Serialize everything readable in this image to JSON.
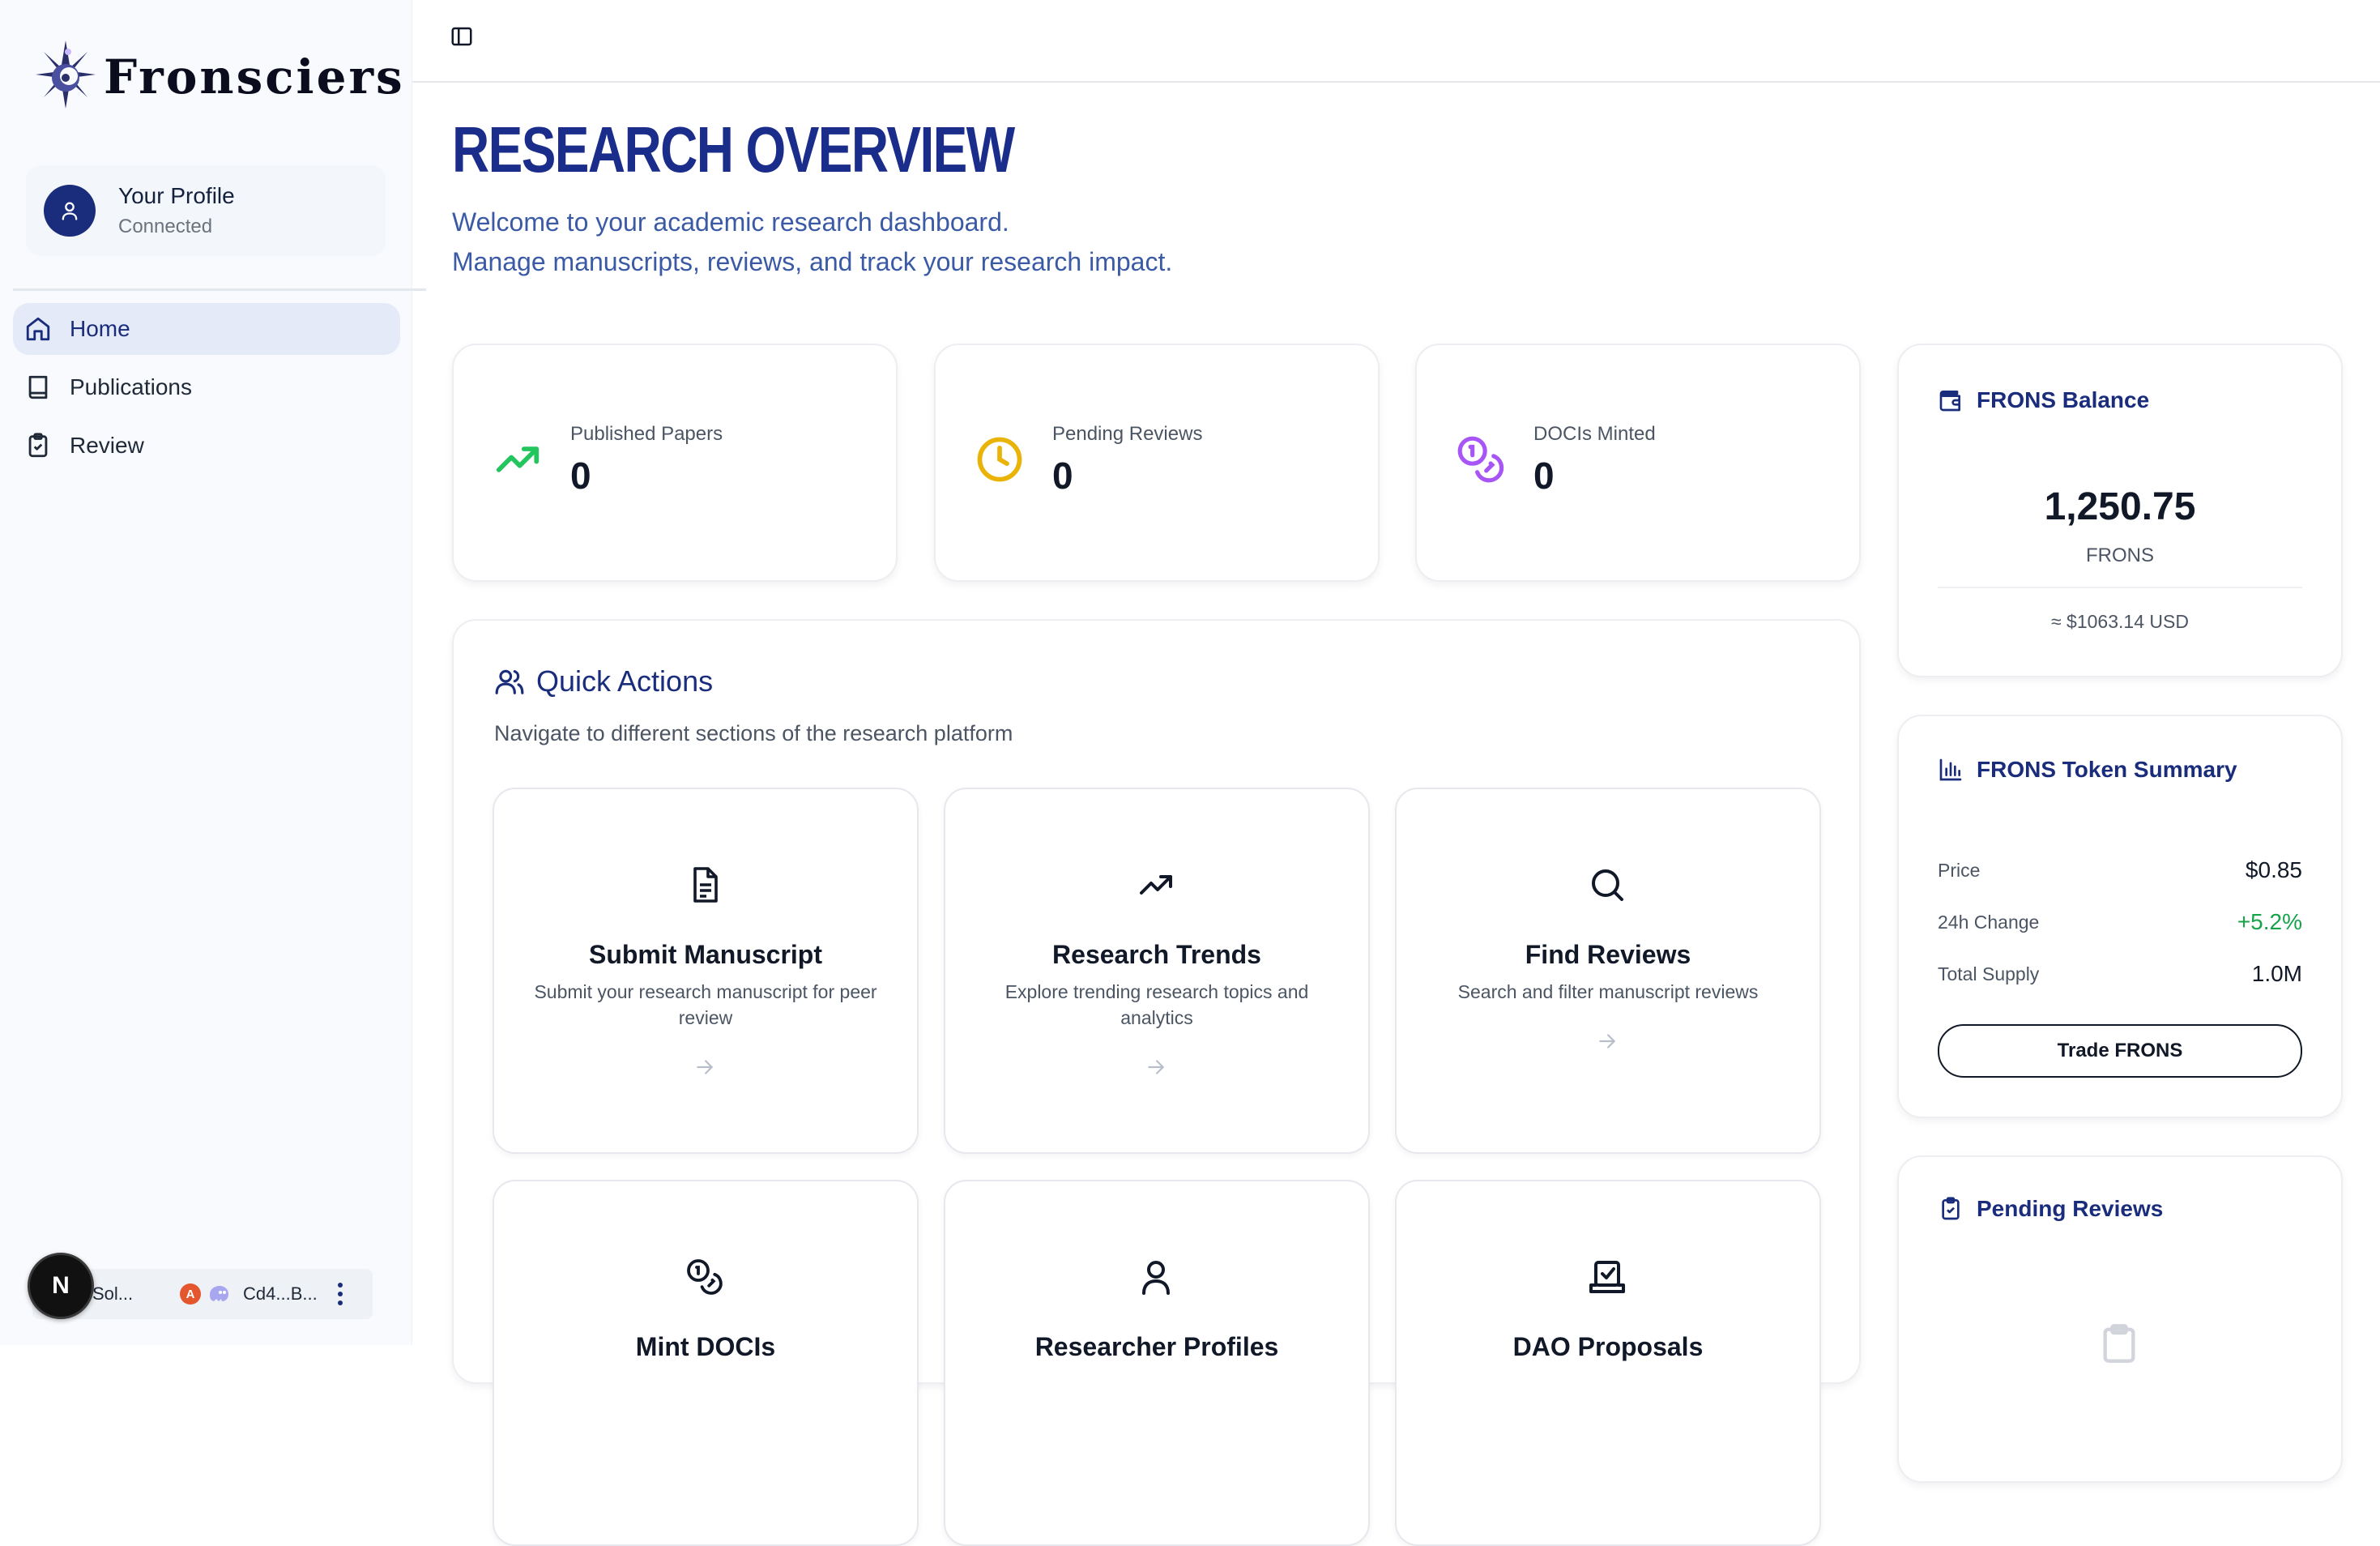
{
  "app": {
    "brand_name": "Fronsciers"
  },
  "profile": {
    "name": "Your Profile",
    "status": "Connected"
  },
  "nav": {
    "items": [
      {
        "label": "Home",
        "icon": "home-icon",
        "active": true
      },
      {
        "label": "Publications",
        "icon": "book-icon",
        "active": false
      },
      {
        "label": "Review",
        "icon": "clipboard-check-icon",
        "active": false
      }
    ]
  },
  "wallet_bar": {
    "badge": "N",
    "network": "Sol...",
    "network_badge": "A",
    "address": "Cd4...B..."
  },
  "page": {
    "title": "RESEARCH OVERVIEW",
    "subtitle_line1": "Welcome to your academic research dashboard.",
    "subtitle_line2": "Manage manuscripts, reviews, and track your research impact."
  },
  "stats": [
    {
      "label": "Published Papers",
      "value": "0",
      "icon": "trending-up-icon",
      "color": "#22c55e"
    },
    {
      "label": "Pending Reviews",
      "value": "0",
      "icon": "clock-icon",
      "color": "#eab308"
    },
    {
      "label": "DOCIs Minted",
      "value": "0",
      "icon": "coins-icon",
      "color": "#a855f7"
    }
  ],
  "quick_actions": {
    "title": "Quick Actions",
    "description": "Navigate to different sections of the research platform",
    "items": [
      {
        "title": "Submit Manuscript",
        "description": "Submit your research manuscript for peer review",
        "icon": "file-text-icon"
      },
      {
        "title": "Research Trends",
        "description": "Explore trending research topics and analytics",
        "icon": "trending-up-icon"
      },
      {
        "title": "Find Reviews",
        "description": "Search and filter manuscript reviews",
        "icon": "search-icon"
      },
      {
        "title": "Mint DOCIs",
        "description": "",
        "icon": "coins-icon"
      },
      {
        "title": "Researcher Profiles",
        "description": "",
        "icon": "user-icon"
      },
      {
        "title": "DAO Proposals",
        "description": "",
        "icon": "vote-icon"
      }
    ]
  },
  "balance": {
    "title": "FRONS Balance",
    "amount": "1,250.75",
    "unit": "FRONS",
    "usd": "≈ $1063.14 USD"
  },
  "token_summary": {
    "title": "FRONS Token Summary",
    "price_label": "Price",
    "price_value": "$0.85",
    "change_label": "24h Change",
    "change_value": "+5.2%",
    "change_color": "#16a34a",
    "supply_label": "Total Supply",
    "supply_value": "1.0M",
    "trade_button": "Trade FRONS"
  },
  "pending_reviews": {
    "title": "Pending Reviews"
  },
  "colors": {
    "brand_blue": "#1a2d8a",
    "active_nav_bg": "#e4eaf8",
    "accent_green": "#22c55e",
    "accent_yellow": "#eab308",
    "accent_purple": "#a855f7"
  }
}
